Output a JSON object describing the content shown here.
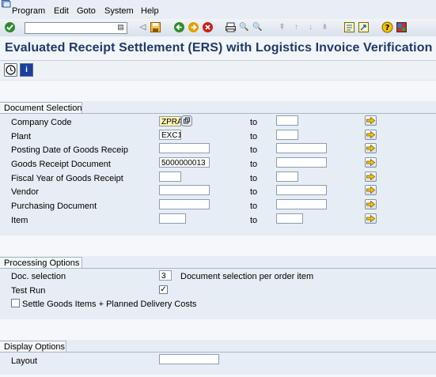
{
  "menu": {
    "items": [
      {
        "label": "Program"
      },
      {
        "label": "Edit"
      },
      {
        "label": "Goto"
      },
      {
        "label": "System"
      },
      {
        "label": "Help"
      }
    ]
  },
  "toolbar": {
    "command_value": "",
    "icons": [
      "checkmark-icon",
      "back-icon",
      "save-icon",
      "back-green-icon",
      "exit-icon",
      "cancel-icon",
      "print-icon",
      "find-icon",
      "find-next-icon",
      "first-page-icon",
      "previous-page-icon",
      "next-page-icon",
      "last-page-icon",
      "create-session-icon",
      "shortcut-icon",
      "help-icon",
      "layout-menu-icon"
    ]
  },
  "title": "Evaluated Receipt Settlement (ERS) with Logistics Invoice Verification",
  "app_toolbar": {
    "icons": [
      "execute-icon",
      "info-icon"
    ]
  },
  "document_selection": {
    "title": "Document Selection",
    "to_label": "to",
    "rows": [
      {
        "label": "Company Code",
        "from": "ZPRA",
        "to": ""
      },
      {
        "label": "Plant",
        "from": "EXC1",
        "to": ""
      },
      {
        "label": "Posting Date of Goods Receip",
        "from": "",
        "to": ""
      },
      {
        "label": "Goods Receipt Document",
        "from": "5000000013",
        "to": ""
      },
      {
        "label": "Fiscal Year of Goods Receipt",
        "from": "",
        "to": ""
      },
      {
        "label": "Vendor",
        "from": "",
        "to": ""
      },
      {
        "label": "Purchasing Document",
        "from": "",
        "to": ""
      },
      {
        "label": "Item",
        "from": "",
        "to": ""
      }
    ]
  },
  "processing_options": {
    "title": "Processing Options",
    "doc_selection_label": "Doc. selection",
    "doc_selection_value": "3",
    "doc_selection_desc": "Document selection per order item",
    "test_run_label": "Test Run",
    "test_run_checked": true,
    "settle_label": "Settle Goods Items + Planned Delivery Costs",
    "settle_checked": false
  },
  "display_options": {
    "title": "Display Options",
    "layout_label": "Layout",
    "layout_value": ""
  },
  "colors": {
    "title": "#1f3a6b",
    "highlight_field": "#fff4b0",
    "arrow": "#f5c400"
  }
}
